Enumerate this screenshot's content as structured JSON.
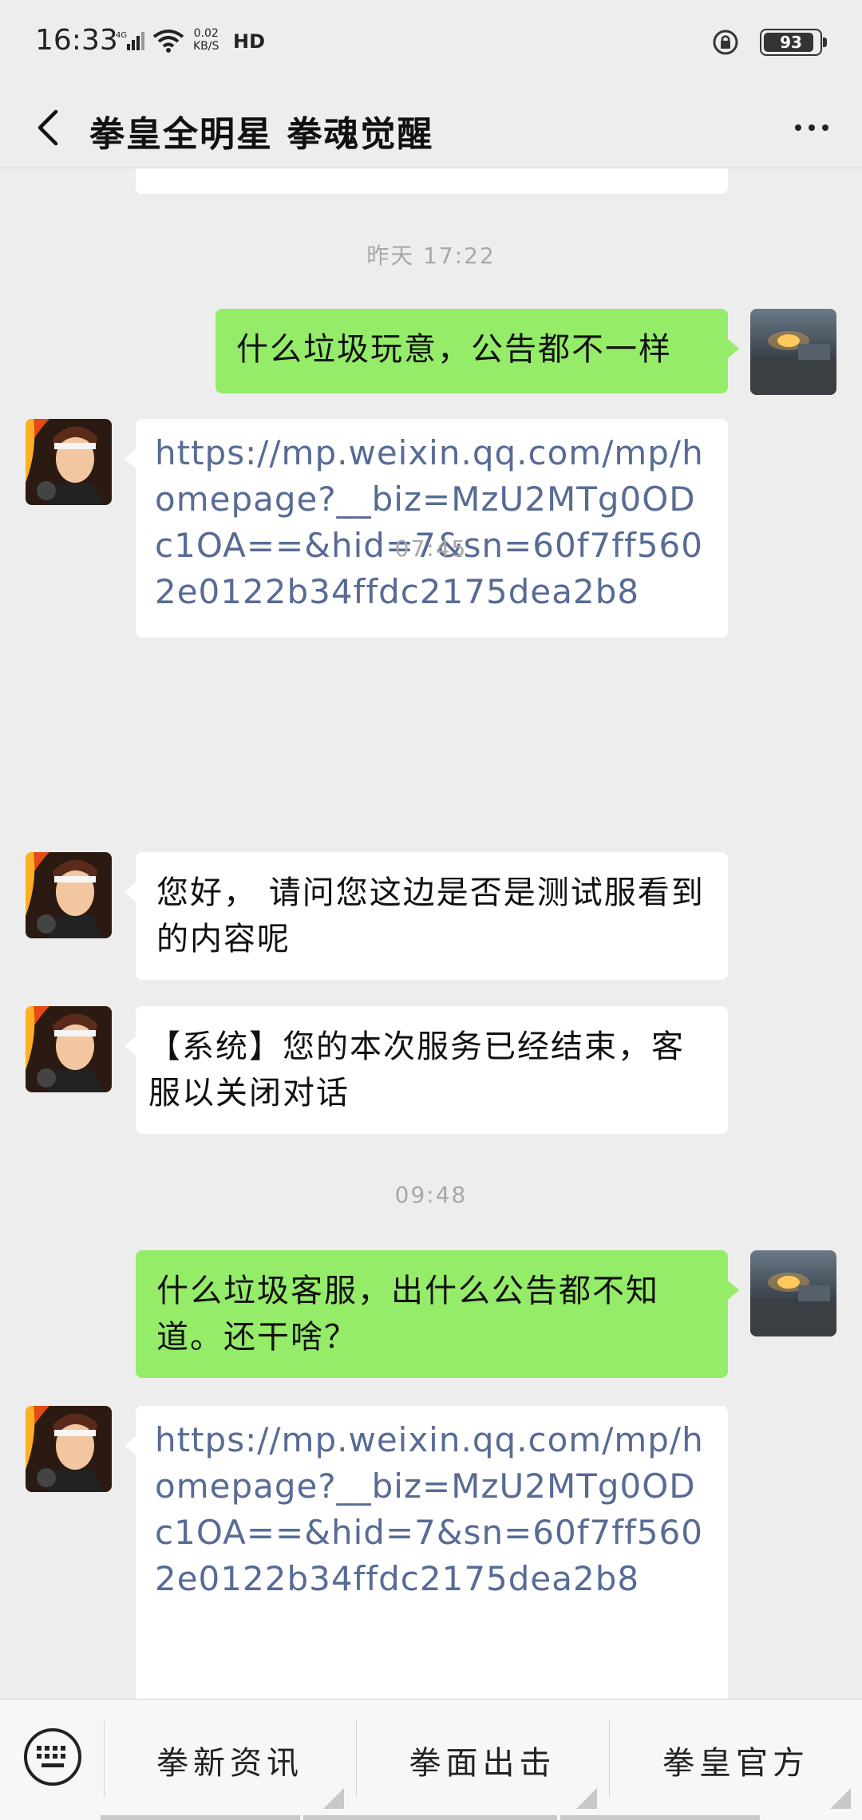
{
  "status_bar": {
    "time": "16:33",
    "network": "4G",
    "speed_value": "0.02",
    "speed_unit": "KB/S",
    "hd": "HD",
    "battery": "93"
  },
  "header": {
    "title": "拳皇全明星 拳魂觉醒"
  },
  "messages": [
    {
      "type": "timestamp",
      "text": "昨天 17:22"
    },
    {
      "type": "outgoing",
      "text": "什么垃圾玩意，公告都不一样"
    },
    {
      "type": "incoming_link",
      "text": "https://mp.weixin.qq.com/mp/homepage?__biz=MzU2MTg0ODc1OA==&hid=7&sn=60f7ff5602e0122b34ffdc2175dea2b8"
    },
    {
      "type": "timestamp",
      "text": "07:45"
    },
    {
      "type": "incoming",
      "text": "您好， 请问您这边是否是测试服看到的内容呢"
    },
    {
      "type": "incoming",
      "text": "【系统】您的本次服务已经结束，客服以关闭对话"
    },
    {
      "type": "timestamp",
      "text": "09:48"
    },
    {
      "type": "outgoing",
      "text": "什么垃圾客服，出什么公告都不知道。还干啥？"
    },
    {
      "type": "incoming_link",
      "text": "https://mp.weixin.qq.com/mp/homepage?__biz=MzU2MTg0ODc1OA==&hid=7&sn=60f7ff5602e0122b34ffdc2175dea2b8"
    }
  ],
  "menu": {
    "items": [
      "拳新资讯",
      "拳面出击",
      "拳皇官方"
    ]
  }
}
